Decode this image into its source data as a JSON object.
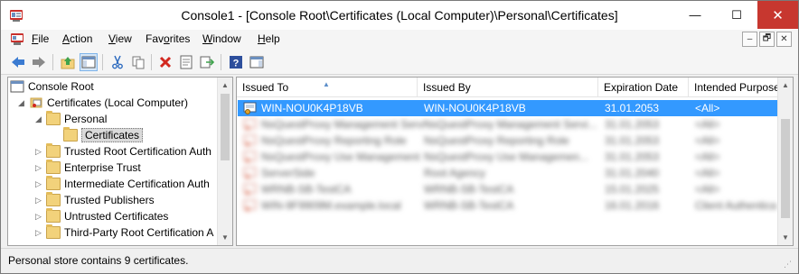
{
  "window": {
    "title": "Console1 - [Console Root\\Certificates (Local Computer)\\Personal\\Certificates]",
    "minimize_glyph": "—",
    "maximize_glyph": "☐",
    "close_glyph": "✕"
  },
  "menu": {
    "items": [
      {
        "label": "File",
        "accel": "F"
      },
      {
        "label": "Action",
        "accel": "A"
      },
      {
        "label": "View",
        "accel": "V"
      },
      {
        "label": "Favorites",
        "accel": "o"
      },
      {
        "label": "Window",
        "accel": "W"
      },
      {
        "label": "Help",
        "accel": "H"
      }
    ],
    "mdi": {
      "minimize": "–",
      "restore": "🗗",
      "close": "✕"
    }
  },
  "toolbar": {
    "buttons": [
      "back-icon",
      "forward-icon",
      "up-folder-icon",
      "show-hide-tree-icon",
      "cut-icon",
      "copy-icon",
      "delete-icon",
      "properties-icon",
      "export-icon",
      "help-icon",
      "action-pane-icon"
    ]
  },
  "tree": {
    "items": [
      {
        "label": "Console Root",
        "level": 0,
        "arrow": "",
        "icon": "console-root-icon"
      },
      {
        "label": "Certificates (Local Computer)",
        "level": 1,
        "arrow": "◢",
        "icon": "certificates-snapin-icon"
      },
      {
        "label": "Personal",
        "level": 2,
        "arrow": "◢",
        "icon": "folder-icon"
      },
      {
        "label": "Certificates",
        "level": 3,
        "arrow": "",
        "icon": "folder-open-icon",
        "selected": true
      },
      {
        "label": "Trusted Root Certification Auth",
        "level": 2,
        "arrow": "▷",
        "icon": "folder-icon"
      },
      {
        "label": "Enterprise Trust",
        "level": 2,
        "arrow": "▷",
        "icon": "folder-icon"
      },
      {
        "label": "Intermediate Certification Auth",
        "level": 2,
        "arrow": "▷",
        "icon": "folder-icon"
      },
      {
        "label": "Trusted Publishers",
        "level": 2,
        "arrow": "▷",
        "icon": "folder-icon"
      },
      {
        "label": "Untrusted Certificates",
        "level": 2,
        "arrow": "▷",
        "icon": "folder-icon"
      },
      {
        "label": "Third-Party Root Certification A",
        "level": 2,
        "arrow": "▷",
        "icon": "folder-icon"
      }
    ]
  },
  "list": {
    "columns": [
      "Issued To",
      "Issued By",
      "Expiration Date",
      "Intended Purpose"
    ],
    "rows": [
      {
        "issued_to": "WIN-NOU0K4P18VB",
        "issued_by": "WIN-NOU0K4P18VB",
        "expiration": "31.01.2053",
        "purpose": "<All>",
        "selected": true,
        "blurred": false
      },
      {
        "issued_to": "NsQuestProxy Management Service",
        "issued_by": "NsQuestProxy Management Servi...",
        "expiration": "31.01.2053",
        "purpose": "<All>",
        "selected": false,
        "blurred": true
      },
      {
        "issued_to": "NsQuestProxy Reporting Role",
        "issued_by": "NsQuestProxy Reporting Role",
        "expiration": "31.01.2053",
        "purpose": "<All>",
        "selected": false,
        "blurred": true
      },
      {
        "issued_to": "NsQuestProxy Use Management",
        "issued_by": "NsQuestProxy Use Managemen...",
        "expiration": "31.01.2053",
        "purpose": "<All>",
        "selected": false,
        "blurred": true
      },
      {
        "issued_to": "ServerSide",
        "issued_by": "Root Agency",
        "expiration": "31.01.2040",
        "purpose": "<All>",
        "selected": false,
        "blurred": true
      },
      {
        "issued_to": "WRNB-SB-TestCA",
        "issued_by": "WRNB-SB-TestCA",
        "expiration": "15.01.2025",
        "purpose": "<All>",
        "selected": false,
        "blurred": true
      },
      {
        "issued_to": "WIN-9F9909M.example.local",
        "issued_by": "WRNB-SB-TestCA",
        "expiration": "16.01.2016",
        "purpose": "Client Authentica...",
        "selected": false,
        "blurred": true
      }
    ]
  },
  "status": {
    "text": "Personal store contains 9 certificates."
  }
}
